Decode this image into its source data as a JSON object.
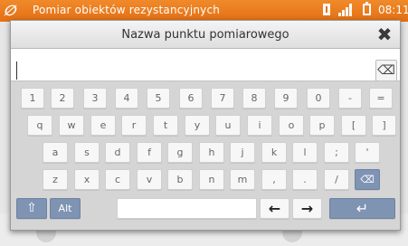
{
  "status_bar": {
    "app_title": "Pomiar obiektów rezystancyjnych",
    "clock": "08:11",
    "accent": "#e46f13"
  },
  "dialog": {
    "title": "Nazwa punktu pomiarowego",
    "close_glyph": "✖",
    "input": {
      "value": "",
      "placeholder": ""
    },
    "eraser_glyph": "⌫"
  },
  "keyboard": {
    "row1": [
      "1",
      "2",
      "3",
      "4",
      "5",
      "6",
      "7",
      "8",
      "9",
      "0",
      "-",
      "="
    ],
    "row2": [
      "q",
      "w",
      "e",
      "r",
      "t",
      "y",
      "u",
      "i",
      "o",
      "p",
      "[",
      "]"
    ],
    "row3": [
      "a",
      "s",
      "d",
      "f",
      "g",
      "h",
      "j",
      "k",
      "l",
      ";",
      "'"
    ],
    "row4": [
      "z",
      "x",
      "c",
      "v",
      "b",
      "n",
      "m",
      ",",
      ".",
      "/"
    ],
    "backspace_glyph": "⌫",
    "shift_glyph": "⇧",
    "alt_label": "Alt",
    "left_arrow": "←",
    "right_arrow": "→",
    "enter_glyph": "↵",
    "key_color": "#f7f7f7",
    "special_key_color": "#7f93b3"
  }
}
